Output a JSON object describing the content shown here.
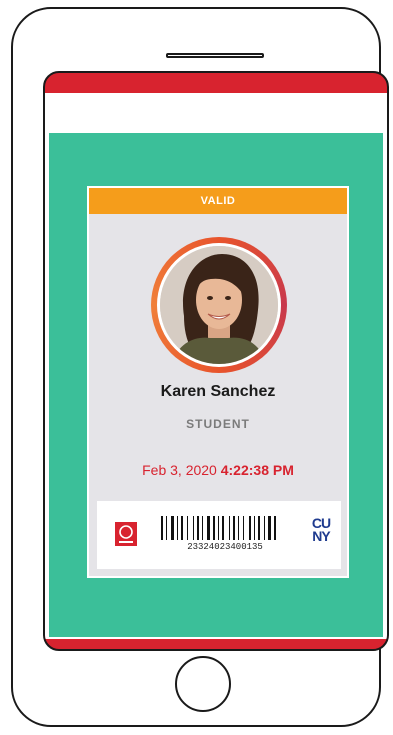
{
  "card": {
    "status": "VALID",
    "name": "Karen Sanchez",
    "role": "STUDENT",
    "date": "Feb 3, 2020",
    "time": "4:22:38 PM",
    "barcode_number": "23324023400135",
    "logo_right_line1": "CU",
    "logo_right_line2": "NY"
  },
  "colors": {
    "frame_red": "#d8232f",
    "background_green": "#3bbf99",
    "valid_orange": "#f59d1b",
    "card_gray": "#e5e4e8",
    "cuny_blue": "#1f3b8f"
  },
  "icons": [
    "speaker-icon",
    "home-button-icon",
    "college-logo-icon",
    "barcode-icon",
    "cuny-logo-icon"
  ]
}
